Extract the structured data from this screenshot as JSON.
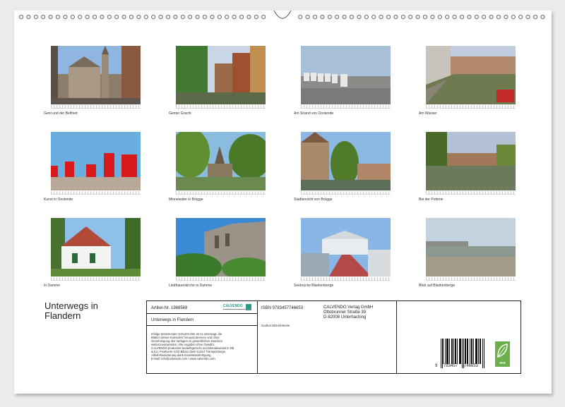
{
  "calendar": {
    "title": "Unterwegs in Flandern"
  },
  "photos": [
    {
      "caption": "Gent und der Belfried"
    },
    {
      "caption": "Genter Gracht"
    },
    {
      "caption": "Am Strand von Oostende"
    },
    {
      "caption": "Am Wasser"
    },
    {
      "caption": "Kunst in Oostende"
    },
    {
      "caption": "Minnewater in Brügge"
    },
    {
      "caption": "Stadtansicht von Brügge"
    },
    {
      "caption": "Bei der Potterie"
    },
    {
      "caption": "In Damme"
    },
    {
      "caption": "Liebfrauenkirche in Damme"
    },
    {
      "caption": "Seebrücke Blankenberge"
    },
    {
      "caption": "Blick auf Blankenberge"
    }
  ],
  "info": {
    "article_no": "Artikel-Nr. 1988569",
    "publisher_logo": "CALVENDO",
    "product_title": "Unterwegs in Flandern",
    "legal_lines": [
      "Infolge bestehender Schutzrechte ist es untersagt, die",
      "Blätter dieses Kalenders herauszutrennen und ohne",
      "Genehmigung des Verlages zu gewerblichen Zwecken",
      "weiterzuverwenden. Alle Angaben ohne Gewähr.",
      "CALVENDO produziert bedarfsgerecht und klimabewusst in DE",
      "& EU. Positivere CO2-Bilanz dank kurzer Transportwege,",
      "Abfall-Reduzierung dank Einzelstückfertigung.",
      "E-Mail: info@calvendo.com • www.calvendo.com"
    ],
    "isbn": "ISBN 9783457746653",
    "author": "Gudrun Nitzold-Briele",
    "publisher_lines": [
      "CALVENDO Verlag GmbH",
      "Ottobrunner Straße 39",
      "D-82008 Unterhaching"
    ],
    "barcode_digits": {
      "first": "9",
      "group1": "783457",
      "group2": "746653"
    },
    "eco_label": "eco"
  },
  "colors": {
    "brand_teal": "#2a9a8a",
    "eco_green": "#6ab04a",
    "border": "#222222"
  }
}
